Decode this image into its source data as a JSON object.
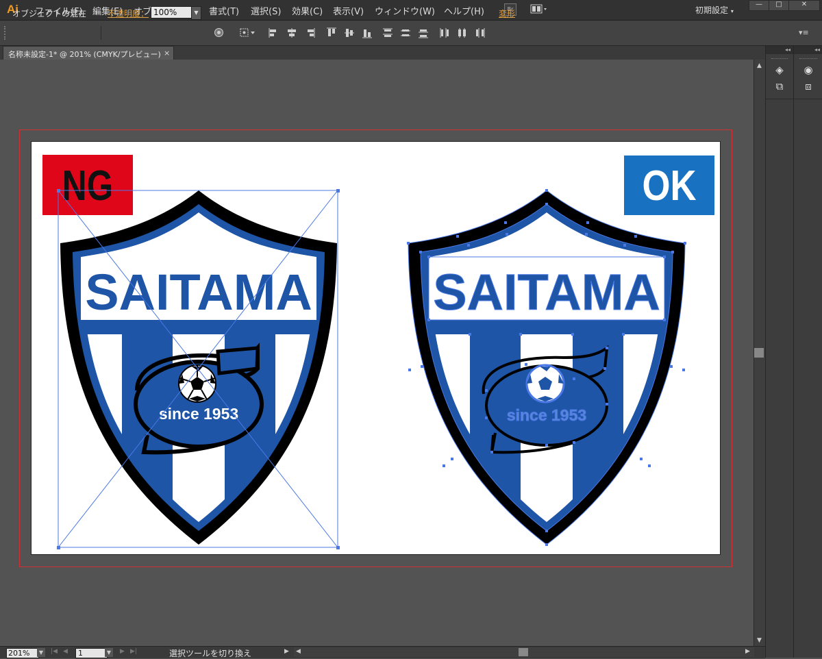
{
  "app": {
    "logo": "Ai"
  },
  "menu": [
    "ファイル(F)",
    "編集(E)",
    "オブジェクト(O)",
    "書式(T)",
    "選択(S)",
    "効果(C)",
    "表示(V)",
    "ウィンドウ(W)",
    "ヘルプ(H)"
  ],
  "app_toolbar": {
    "bridge_label": "Br"
  },
  "workspace": {
    "label": "初期設定"
  },
  "control": {
    "selection_label": "オブジェクトの混在",
    "opacity_label": "不透明度：",
    "opacity_value": "100%",
    "transform_label": "変形"
  },
  "document": {
    "tab_title": "名称未設定-1* @ 201% (CMYK/プレビュー)",
    "close_glyph": "×"
  },
  "artwork": {
    "ng_label": "NG",
    "ok_label": "OK",
    "crest_word": "SAITAMA",
    "since_text": "since 1953"
  },
  "status": {
    "zoom": "201%",
    "page": "1",
    "tool_text": "選択ツールを切り換え"
  },
  "colors": {
    "ng_red": "#e00619",
    "ok_blue": "#1971c2",
    "crest_blue": "#1e55a6",
    "selection_blue": "#4a78e6"
  },
  "icons": [
    "layers-icon",
    "artboards-icon",
    "appearance-icon",
    "graphic-styles-icon",
    "align-left-icon",
    "align-center-icon",
    "align-right-icon",
    "distribute-icon"
  ]
}
